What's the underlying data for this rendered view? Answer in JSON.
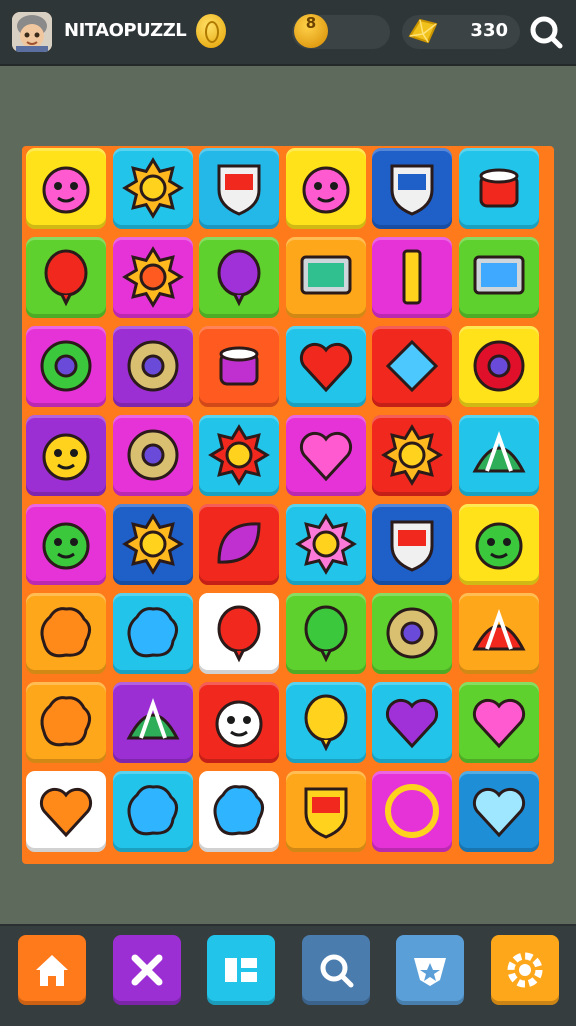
{
  "header": {
    "title": "NITAOPUZZL",
    "coin_value": "8",
    "gem_count": "330",
    "avatar_icon": "player-avatar-icon",
    "search_icon": "search-icon"
  },
  "colors": {
    "topbar": "#2f3638",
    "background": "#5e6a5c",
    "board_frame": "#ff7a1a",
    "bottombar": "#353d3f"
  },
  "board": {
    "rows": 8,
    "cols": 6,
    "tiles": [
      [
        {
          "color": "#ffe21a",
          "icon": "pink-hat-bear-icon"
        },
        {
          "color": "#23c4ea",
          "icon": "sunflower-icon"
        },
        {
          "color": "#23b8e8",
          "icon": "shield-crest-icon"
        },
        {
          "color": "#ffe21a",
          "icon": "pink-flame-creature-icon"
        },
        {
          "color": "#1e5fc8",
          "icon": "blue-shield-crest-icon"
        },
        {
          "color": "#23c4ea",
          "icon": "cake-icon"
        }
      ],
      [
        {
          "color": "#5fd12e",
          "icon": "red-balloon-icon"
        },
        {
          "color": "#e533d8",
          "icon": "orange-sun-icon"
        },
        {
          "color": "#5fd12e",
          "icon": "purple-balloon-icon"
        },
        {
          "color": "#ffa71a",
          "icon": "tv-screen-icon"
        },
        {
          "color": "#e533d8",
          "icon": "yellow-pillar-icon"
        },
        {
          "color": "#5fd12e",
          "icon": "laptop-icon"
        }
      ],
      [
        {
          "color": "#e533d8",
          "icon": "green-gear-icon"
        },
        {
          "color": "#9b2fd4",
          "icon": "target-ring-icon"
        },
        {
          "color": "#ff5a1f",
          "icon": "purple-pot-icon"
        },
        {
          "color": "#23c4ea",
          "icon": "red-heart-icon"
        },
        {
          "color": "#f0281e",
          "icon": "blue-diamond-icon"
        },
        {
          "color": "#ffe21a",
          "icon": "magnifier-donut-icon"
        }
      ],
      [
        {
          "color": "#9b2fd4",
          "icon": "yellow-critter-icon"
        },
        {
          "color": "#e533d8",
          "icon": "dial-ring-icon"
        },
        {
          "color": "#23c4ea",
          "icon": "red-sun-face-icon"
        },
        {
          "color": "#e533d8",
          "icon": "pink-heart-icon"
        },
        {
          "color": "#f0281e",
          "icon": "yellow-star-icon"
        },
        {
          "color": "#23c4ea",
          "icon": "striped-umbrella-icon"
        }
      ],
      [
        {
          "color": "#e533d8",
          "icon": "green-alien-icon"
        },
        {
          "color": "#1e5fc8",
          "icon": "sunflower-face-icon"
        },
        {
          "color": "#f0281e",
          "icon": "purple-leaf-icon"
        },
        {
          "color": "#23c4ea",
          "icon": "pink-flower-face-icon"
        },
        {
          "color": "#1e5fc8",
          "icon": "ornate-banner-icon"
        },
        {
          "color": "#ffe21a",
          "icon": "green-turtle-icon"
        }
      ],
      [
        {
          "color": "#ffa71a",
          "icon": "orange-blob-icon"
        },
        {
          "color": "#23c4ea",
          "icon": "blue-blob-icon"
        },
        {
          "color": "#ffffff",
          "icon": "lollipop-icon"
        },
        {
          "color": "#5fd12e",
          "icon": "green-balloon-icon"
        },
        {
          "color": "#5fd12e",
          "icon": "wheel-icon"
        },
        {
          "color": "#ffa71a",
          "icon": "watermelon-slice-icon"
        }
      ],
      [
        {
          "color": "#ffa71a",
          "icon": "orange-blob-icon"
        },
        {
          "color": "#9b2fd4",
          "icon": "striped-tent-icon"
        },
        {
          "color": "#f0281e",
          "icon": "white-ghost-icon"
        },
        {
          "color": "#23c4ea",
          "icon": "yellow-drop-icon"
        },
        {
          "color": "#23c4ea",
          "icon": "purple-heart-icon"
        },
        {
          "color": "#5fd12e",
          "icon": "pink-heart-icon"
        }
      ],
      [
        {
          "color": "#ffffff",
          "icon": "orange-heart-icon"
        },
        {
          "color": "#23c4ea",
          "icon": "blue-bubble-icon"
        },
        {
          "color": "#ffffff",
          "icon": "blue-bubble-icon"
        },
        {
          "color": "#ffa71a",
          "icon": "yellow-shield-icon"
        },
        {
          "color": "#e533d8",
          "icon": "gold-ring-icon"
        },
        {
          "color": "#1e8fd6",
          "icon": "light-blue-heart-icon"
        }
      ]
    ]
  },
  "nav": [
    {
      "icon": "home-icon",
      "color": "#ff7a1a"
    },
    {
      "icon": "close-icon",
      "color": "#9b2fd4"
    },
    {
      "icon": "grid-icon",
      "color": "#23c4ea"
    },
    {
      "icon": "search-icon",
      "color": "#4a7cae"
    },
    {
      "icon": "star-badge-icon",
      "color": "#5a9fd8"
    },
    {
      "icon": "settings-gear-icon",
      "color": "#ffa71a"
    }
  ]
}
